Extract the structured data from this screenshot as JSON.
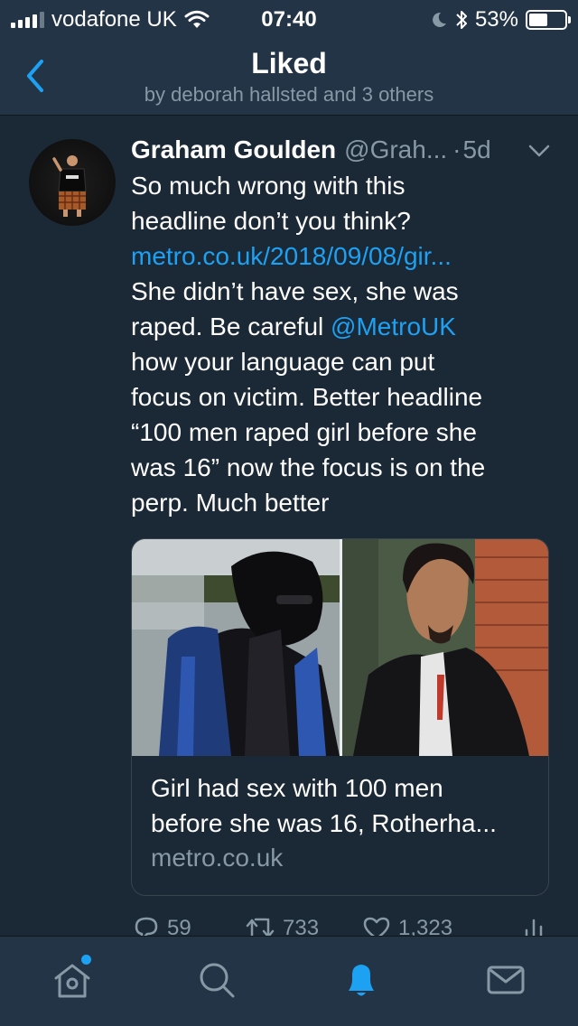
{
  "status_bar": {
    "carrier": "vodafone UK",
    "time": "07:40",
    "battery": "53%",
    "battery_level": 0.53
  },
  "header": {
    "title": "Liked",
    "subtitle": "by deborah hallsted and 3 others"
  },
  "tweet": {
    "name": "Graham Goulden",
    "handle": "@Grah...",
    "dot": "·",
    "time": "5d",
    "text_lines": [
      "So much wrong with this",
      "headline don’t you think?",
      "metro.co.uk/2018/09/08/gir...",
      "She didn’t have sex, she was",
      "raped. Be careful ",
      "@MetroUK",
      "how your language can put",
      "focus on victim. Better headline",
      "“100 men raped girl before she",
      "was 16” now the focus is on the",
      "perp. Much better"
    ],
    "card": {
      "title_lines": [
        "Girl had sex with 100 men",
        "before she was 16, Rotherha..."
      ],
      "domain": "metro.co.uk"
    },
    "counts": {
      "replies": "59",
      "retweets": "733",
      "likes": "1,323"
    }
  },
  "colors": {
    "background": "#1b2836",
    "header": "#243447",
    "accent": "#1da1f2",
    "secondary_text": "#8899a6"
  },
  "tabs": [
    {
      "name": "home-icon"
    },
    {
      "name": "search-icon"
    },
    {
      "name": "notifications-icon"
    },
    {
      "name": "messages-icon"
    }
  ]
}
